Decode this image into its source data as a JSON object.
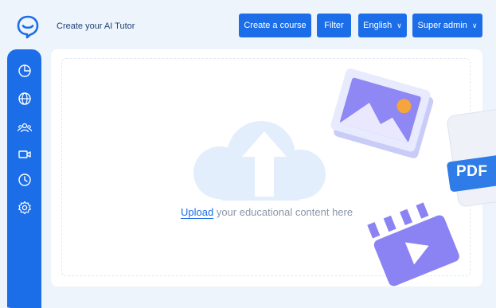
{
  "header": {
    "title": "Create your AI Tutor",
    "buttons": {
      "create_course": "Create a course",
      "filter": "Filter",
      "language": "English",
      "role": "Super admin"
    }
  },
  "sidebar": {
    "items": [
      "dashboard-icon",
      "globe-icon",
      "users-icon",
      "video-icon",
      "clock-icon",
      "settings-icon"
    ]
  },
  "upload": {
    "link_label": "Upload",
    "message": " your educational content here"
  },
  "illustrations": {
    "pdf_label": "PDF"
  },
  "colors": {
    "accent": "#1c6ee8",
    "background": "#eef4fb",
    "illustration_purple": "#8b83f3"
  }
}
